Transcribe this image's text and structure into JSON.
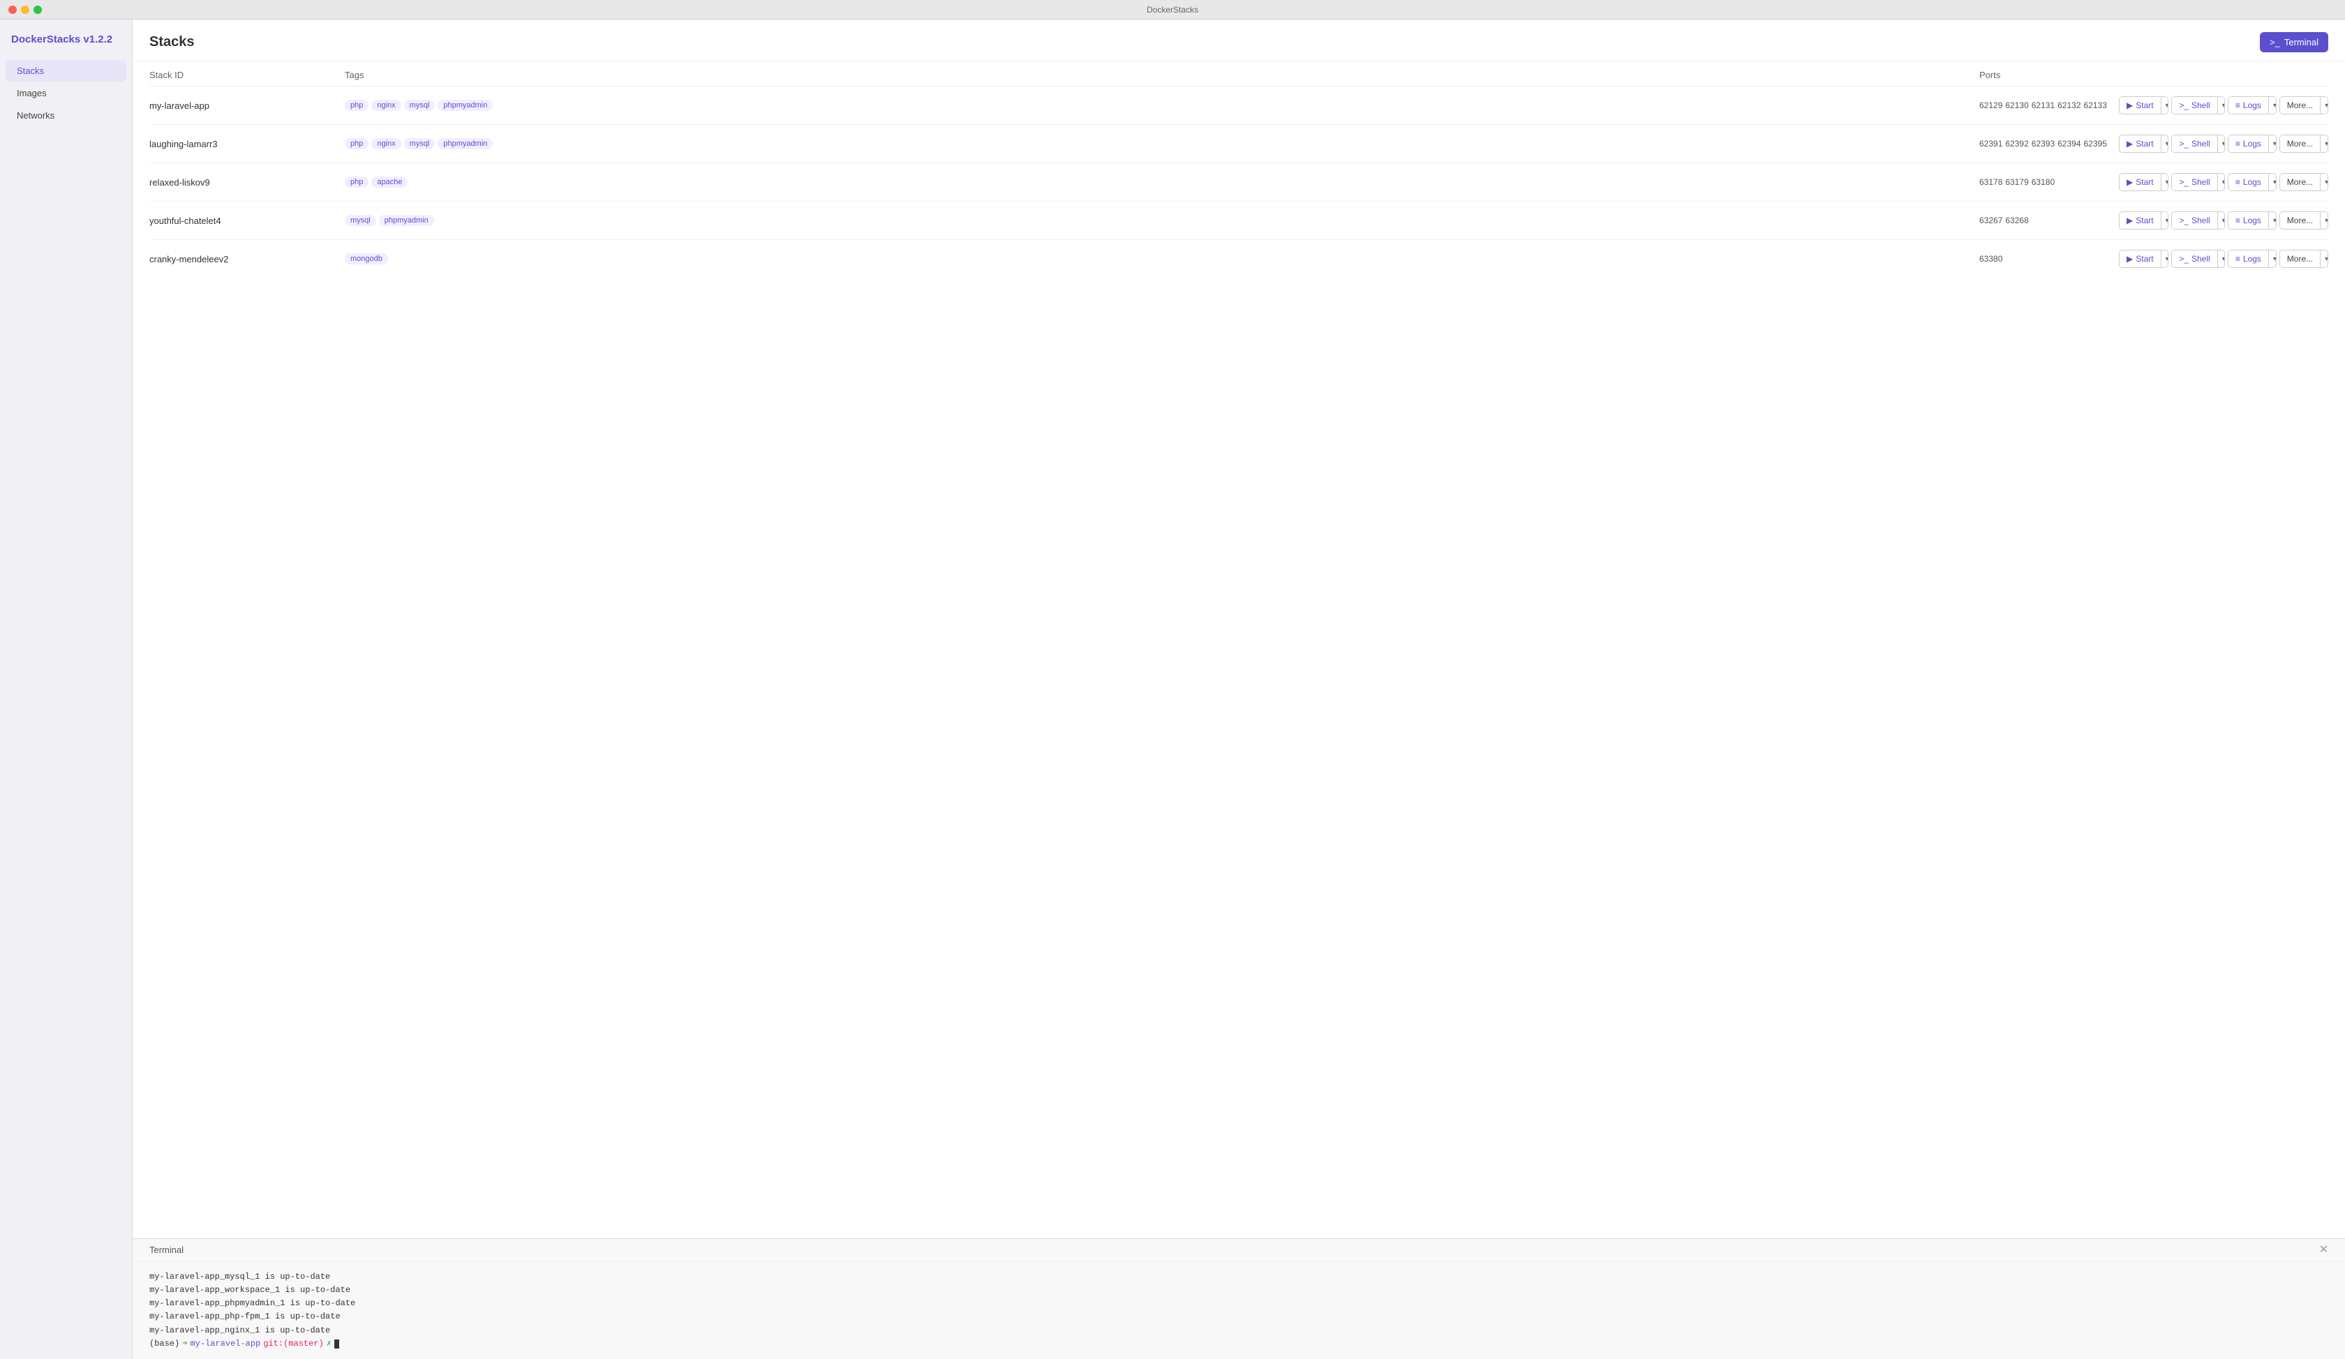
{
  "window": {
    "title": "DockerStacks"
  },
  "sidebar": {
    "app_title": "DockerStacks v1.2.2",
    "items": [
      {
        "id": "stacks",
        "label": "Stacks",
        "active": true
      },
      {
        "id": "images",
        "label": "Images",
        "active": false
      },
      {
        "id": "networks",
        "label": "Networks",
        "active": false
      }
    ]
  },
  "main": {
    "title": "Stacks",
    "terminal_button": "Terminal"
  },
  "table": {
    "headers": {
      "stack_id": "Stack ID",
      "tags": "Tags",
      "ports": "Ports"
    },
    "rows": [
      {
        "id": "my-laravel-app",
        "tags": [
          "php",
          "nginx",
          "mysql",
          "phpmyadmin"
        ],
        "ports": [
          "62129",
          "62130",
          "62131",
          "62132",
          "62133"
        ],
        "actions": {
          "start": "Start",
          "shell": "Shell",
          "logs": "Logs",
          "more": "More..."
        }
      },
      {
        "id": "laughing-lamarr3",
        "tags": [
          "php",
          "nginx",
          "mysql",
          "phpmyadmin"
        ],
        "ports": [
          "62391",
          "62392",
          "62393",
          "62394",
          "62395"
        ],
        "actions": {
          "start": "Start",
          "shell": "Shell",
          "logs": "Logs",
          "more": "More..."
        }
      },
      {
        "id": "relaxed-liskov9",
        "tags": [
          "php",
          "apache"
        ],
        "ports": [
          "63178",
          "63179",
          "63180"
        ],
        "actions": {
          "start": "Start",
          "shell": "Shell",
          "logs": "Logs",
          "more": "More..."
        }
      },
      {
        "id": "youthful-chatelet4",
        "tags": [
          "mysql",
          "phpmyadmin"
        ],
        "ports": [
          "63267",
          "63268"
        ],
        "actions": {
          "start": "Start",
          "shell": "Shell",
          "logs": "Logs",
          "more": "More..."
        }
      },
      {
        "id": "cranky-mendeleev2",
        "tags": [
          "mongodb"
        ],
        "ports": [
          "63380"
        ],
        "actions": {
          "start": "Start",
          "shell": "Shell",
          "logs": "Logs",
          "more": "More..."
        }
      }
    ]
  },
  "terminal": {
    "label": "Terminal",
    "lines": [
      "my-laravel-app_mysql_1 is up-to-date",
      "my-laravel-app_workspace_1 is up-to-date",
      "my-laravel-app_phpmyadmin_1 is up-to-date",
      "my-laravel-app_php-fpm_1 is up-to-date",
      "my-laravel-app_nginx_1 is up-to-date"
    ],
    "prompt": {
      "base": "(base)",
      "arrow": "➜",
      "path": "my-laravel-app",
      "git_label": "git:",
      "git_branch": "(master)",
      "symbol": "✗"
    }
  },
  "icons": {
    "terminal": ">_",
    "start": "▶",
    "shell": ">_",
    "logs": "≡",
    "more": "...",
    "caret": "▾",
    "close": "✕"
  }
}
